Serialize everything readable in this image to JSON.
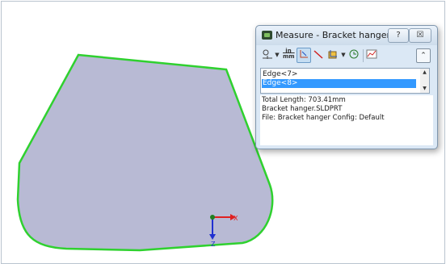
{
  "dialog": {
    "title": "Measure - Bracket hanger",
    "help_label": "?",
    "close_label": "☒",
    "toolbar": {
      "units_top": "in",
      "units_bottom": "mm",
      "collapse_label": "⌃"
    },
    "selection_list": [
      "Edge<7>",
      "Edge<8>"
    ],
    "selected_index": 1,
    "results": {
      "total_length": "Total Length: 703.41mm",
      "part": "Bracket hanger.SLDPRT",
      "file": "File: Bracket hanger Config: Default"
    }
  },
  "triad": {
    "x_label": "X",
    "z_label": "Z"
  },
  "colors": {
    "face_fill": "#b8bad4",
    "edge_highlight": "#2fd12f",
    "selection_blue": "#3399ff"
  }
}
